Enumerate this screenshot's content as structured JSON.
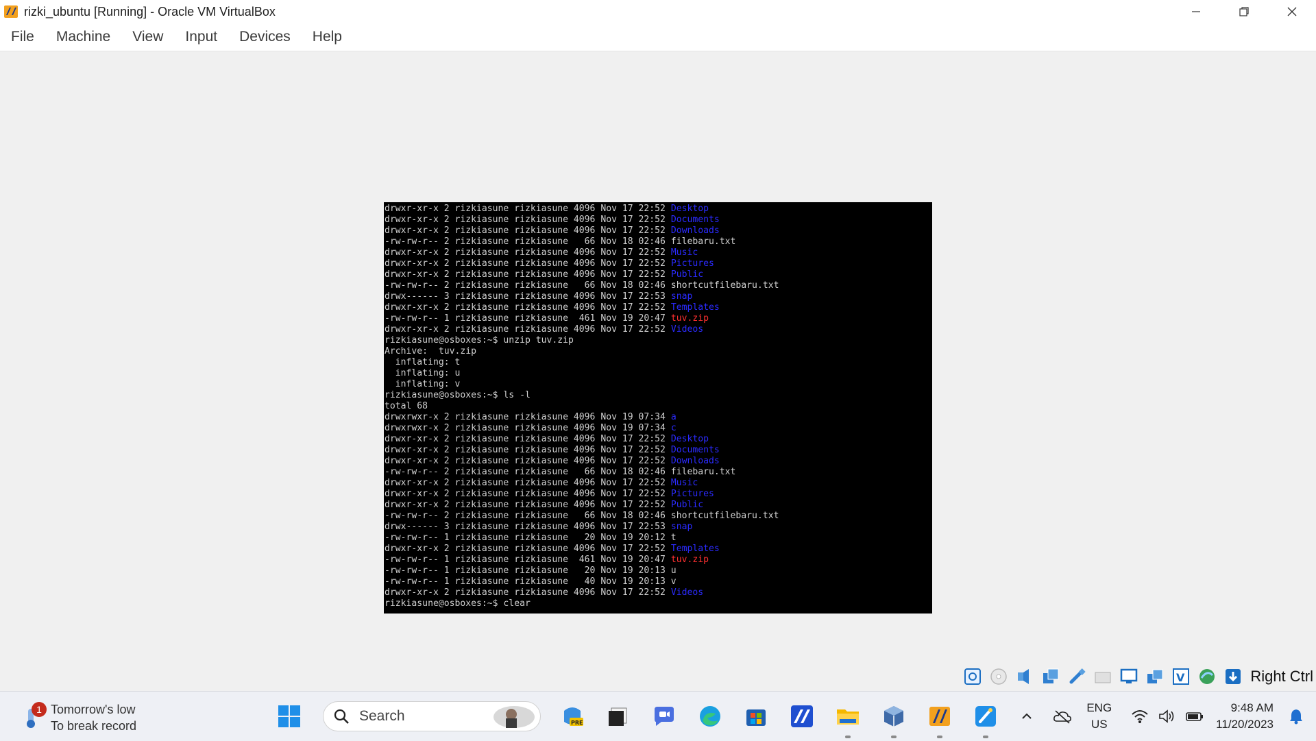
{
  "window": {
    "title": "rizki_ubuntu [Running] - Oracle VM VirtualBox",
    "minimize_icon": "minimize-icon",
    "restore_icon": "restore-icon",
    "close_icon": "close-icon"
  },
  "menu": {
    "items": [
      "File",
      "Machine",
      "View",
      "Input",
      "Devices",
      "Help"
    ]
  },
  "terminal": {
    "lines": [
      {
        "text": "drwxr-xr-x 2 rizkiasune rizkiasune 4096 Nov 17 22:52 ",
        "name": "Desktop",
        "kind": "dir"
      },
      {
        "text": "drwxr-xr-x 2 rizkiasune rizkiasune 4096 Nov 17 22:52 ",
        "name": "Documents",
        "kind": "dir"
      },
      {
        "text": "drwxr-xr-x 2 rizkiasune rizkiasune 4096 Nov 17 22:52 ",
        "name": "Downloads",
        "kind": "dir"
      },
      {
        "text": "-rw-rw-r-- 2 rizkiasune rizkiasune   66 Nov 18 02:46 filebaru.txt",
        "name": "",
        "kind": "plain"
      },
      {
        "text": "drwxr-xr-x 2 rizkiasune rizkiasune 4096 Nov 17 22:52 ",
        "name": "Music",
        "kind": "dir"
      },
      {
        "text": "drwxr-xr-x 2 rizkiasune rizkiasune 4096 Nov 17 22:52 ",
        "name": "Pictures",
        "kind": "dir"
      },
      {
        "text": "drwxr-xr-x 2 rizkiasune rizkiasune 4096 Nov 17 22:52 ",
        "name": "Public",
        "kind": "dir"
      },
      {
        "text": "-rw-rw-r-- 2 rizkiasune rizkiasune   66 Nov 18 02:46 shortcutfilebaru.txt",
        "name": "",
        "kind": "plain"
      },
      {
        "text": "drwx------ 3 rizkiasune rizkiasune 4096 Nov 17 22:53 ",
        "name": "snap",
        "kind": "dir"
      },
      {
        "text": "drwxr-xr-x 2 rizkiasune rizkiasune 4096 Nov 17 22:52 ",
        "name": "Templates",
        "kind": "dir"
      },
      {
        "text": "-rw-rw-r-- 1 rizkiasune rizkiasune  461 Nov 19 20:47 ",
        "name": "tuv.zip",
        "kind": "zip"
      },
      {
        "text": "drwxr-xr-x 2 rizkiasune rizkiasune 4096 Nov 17 22:52 ",
        "name": "Videos",
        "kind": "dir"
      },
      {
        "text": "rizkiasune@osboxes:~$ unzip tuv.zip",
        "name": "",
        "kind": "plain"
      },
      {
        "text": "Archive:  tuv.zip",
        "name": "",
        "kind": "plain"
      },
      {
        "text": "  inflating: t",
        "name": "",
        "kind": "plain"
      },
      {
        "text": "  inflating: u",
        "name": "",
        "kind": "plain"
      },
      {
        "text": "  inflating: v",
        "name": "",
        "kind": "plain"
      },
      {
        "text": "rizkiasune@osboxes:~$ ls -l",
        "name": "",
        "kind": "plain"
      },
      {
        "text": "total 68",
        "name": "",
        "kind": "plain"
      },
      {
        "text": "drwxrwxr-x 2 rizkiasune rizkiasune 4096 Nov 19 07:34 ",
        "name": "a",
        "kind": "dir"
      },
      {
        "text": "drwxrwxr-x 2 rizkiasune rizkiasune 4096 Nov 19 07:34 ",
        "name": "c",
        "kind": "dir"
      },
      {
        "text": "drwxr-xr-x 2 rizkiasune rizkiasune 4096 Nov 17 22:52 ",
        "name": "Desktop",
        "kind": "dir"
      },
      {
        "text": "drwxr-xr-x 2 rizkiasune rizkiasune 4096 Nov 17 22:52 ",
        "name": "Documents",
        "kind": "dir"
      },
      {
        "text": "drwxr-xr-x 2 rizkiasune rizkiasune 4096 Nov 17 22:52 ",
        "name": "Downloads",
        "kind": "dir"
      },
      {
        "text": "-rw-rw-r-- 2 rizkiasune rizkiasune   66 Nov 18 02:46 filebaru.txt",
        "name": "",
        "kind": "plain"
      },
      {
        "text": "drwxr-xr-x 2 rizkiasune rizkiasune 4096 Nov 17 22:52 ",
        "name": "Music",
        "kind": "dir"
      },
      {
        "text": "drwxr-xr-x 2 rizkiasune rizkiasune 4096 Nov 17 22:52 ",
        "name": "Pictures",
        "kind": "dir"
      },
      {
        "text": "drwxr-xr-x 2 rizkiasune rizkiasune 4096 Nov 17 22:52 ",
        "name": "Public",
        "kind": "dir"
      },
      {
        "text": "-rw-rw-r-- 2 rizkiasune rizkiasune   66 Nov 18 02:46 shortcutfilebaru.txt",
        "name": "",
        "kind": "plain"
      },
      {
        "text": "drwx------ 3 rizkiasune rizkiasune 4096 Nov 17 22:53 ",
        "name": "snap",
        "kind": "dir"
      },
      {
        "text": "-rw-rw-r-- 1 rizkiasune rizkiasune   20 Nov 19 20:12 t",
        "name": "",
        "kind": "plain"
      },
      {
        "text": "drwxr-xr-x 2 rizkiasune rizkiasune 4096 Nov 17 22:52 ",
        "name": "Templates",
        "kind": "dir"
      },
      {
        "text": "-rw-rw-r-- 1 rizkiasune rizkiasune  461 Nov 19 20:47 ",
        "name": "tuv.zip",
        "kind": "zip"
      },
      {
        "text": "-rw-rw-r-- 1 rizkiasune rizkiasune   20 Nov 19 20:13 u",
        "name": "",
        "kind": "plain"
      },
      {
        "text": "-rw-rw-r-- 1 rizkiasune rizkiasune   40 Nov 19 20:13 v",
        "name": "",
        "kind": "plain"
      },
      {
        "text": "drwxr-xr-x 2 rizkiasune rizkiasune 4096 Nov 17 22:52 ",
        "name": "Videos",
        "kind": "dir"
      },
      {
        "text": "rizkiasune@osboxes:~$ clear",
        "name": "",
        "kind": "plain"
      }
    ],
    "colors": {
      "background": "#000000",
      "text": "#d0d0d0",
      "dir": "#2b2bff",
      "zip": "#ff3030"
    }
  },
  "vbox_status": {
    "icons": [
      "hard-disk-icon",
      "optical-drive-icon",
      "audio-icon",
      "network-icon",
      "usb-icon",
      "shared-folders-icon",
      "display-icon",
      "recording-icon",
      "vt-x-icon",
      "guest-additions-icon",
      "mouse-integration-icon"
    ],
    "host_key": "Right Ctrl"
  },
  "taskbar": {
    "weather": {
      "line1": "Tomorrow's low",
      "line2": "To break record",
      "badge": "1"
    },
    "search": {
      "label": "Search"
    },
    "pinned": [
      "start-icon",
      "copilot-icon",
      "task-view-icon",
      "chat-icon",
      "edge-icon",
      "store-icon",
      "app-icon",
      "file-explorer-icon",
      "virtualbox-manager-icon",
      "virtualbox-vm-icon",
      "paint-icon"
    ],
    "tray": {
      "language": "ENG",
      "region": "US",
      "time": "9:48 AM",
      "date": "11/20/2023"
    }
  }
}
